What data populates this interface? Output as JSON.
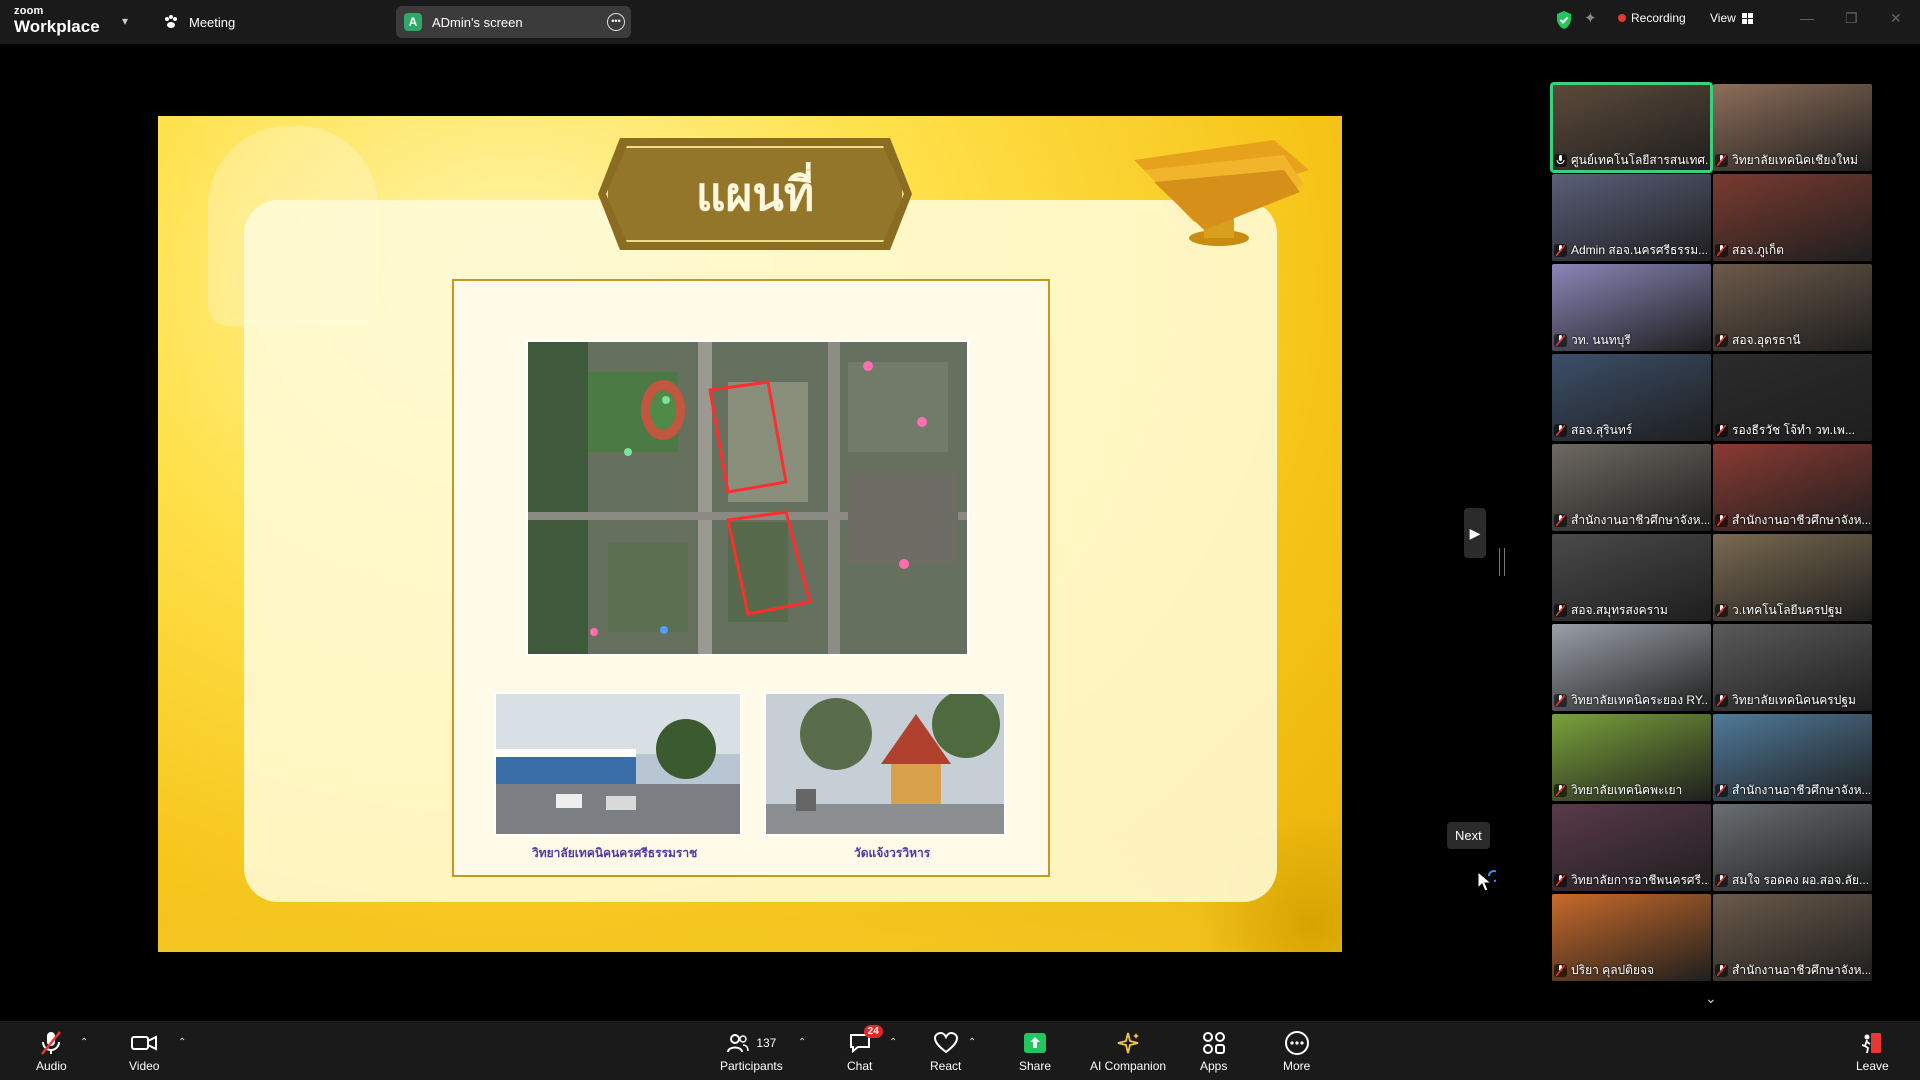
{
  "app": {
    "brand_small": "zoom",
    "brand_big": "Workplace",
    "meeting_label": "Meeting",
    "screen_owner_initial": "A",
    "screen_title": "ADmin's screen",
    "recording_label": "Recording",
    "view_label": "View"
  },
  "slide": {
    "title": "แผนที่",
    "caption_left": "วิทยาลัยเทคนิคนครศรีธรรมราช",
    "caption_right": "วัดแจ้งวรวิหาร",
    "next_tooltip": "Next"
  },
  "gallery": {
    "participants": [
      {
        "name": "ศูนย์เทคโนโลยีสารสนเทศ...",
        "muted": false,
        "active": true
      },
      {
        "name": "วิทยาลัยเทคนิคเชียงใหม่",
        "muted": true
      },
      {
        "name": "Admin สอจ.นครศรีธรรม...",
        "muted": true
      },
      {
        "name": "สอจ.ภูเก็ต",
        "muted": true
      },
      {
        "name": "วท. นนทบุรี",
        "muted": true
      },
      {
        "name": "สอจ.อุดรธานี",
        "muted": true
      },
      {
        "name": "สอจ.สุรินทร์",
        "muted": true
      },
      {
        "name": "รองธีรวัช โจ้ทำ วท.เพ...",
        "muted": true
      },
      {
        "name": "สำนักงานอาชีวศึกษาจังห...",
        "muted": true
      },
      {
        "name": "สำนักงานอาชีวศึกษาจังห...",
        "muted": true
      },
      {
        "name": "สอจ.สมุทรสงคราม",
        "muted": true
      },
      {
        "name": "ว.เทคโนโลยีนครปฐม",
        "muted": true
      },
      {
        "name": "วิทยาลัยเทคนิคระยอง RY...",
        "muted": true
      },
      {
        "name": "วิทยาลัยเทคนิคนครปฐม",
        "muted": true
      },
      {
        "name": "วิทยาลัยเทคนิคพะเยา",
        "muted": true
      },
      {
        "name": "สำนักงานอาชีวศึกษาจังห...",
        "muted": true
      },
      {
        "name": "วิทยาลัยการอาชีพนครศรี...",
        "muted": true
      },
      {
        "name": "สมใจ รอดคง ผอ.สอจ.ลัย...",
        "muted": true
      },
      {
        "name": "ปริยา คุลปติยจจ",
        "muted": true
      },
      {
        "name": "สำนักงานอาชีวศึกษาจังห...",
        "muted": true
      }
    ]
  },
  "toolbar": {
    "audio": "Audio",
    "video": "Video",
    "participants": "Participants",
    "participants_count": "137",
    "chat": "Chat",
    "chat_badge": "24",
    "react": "React",
    "share": "Share",
    "ai_companion": "AI Companion",
    "apps": "Apps",
    "more": "More",
    "leave": "Leave"
  },
  "colors": {
    "active_speaker": "#3ccf7c",
    "share_green": "#22c55e",
    "mute_red": "#e53935",
    "ai_yellow": "#f4c542"
  }
}
